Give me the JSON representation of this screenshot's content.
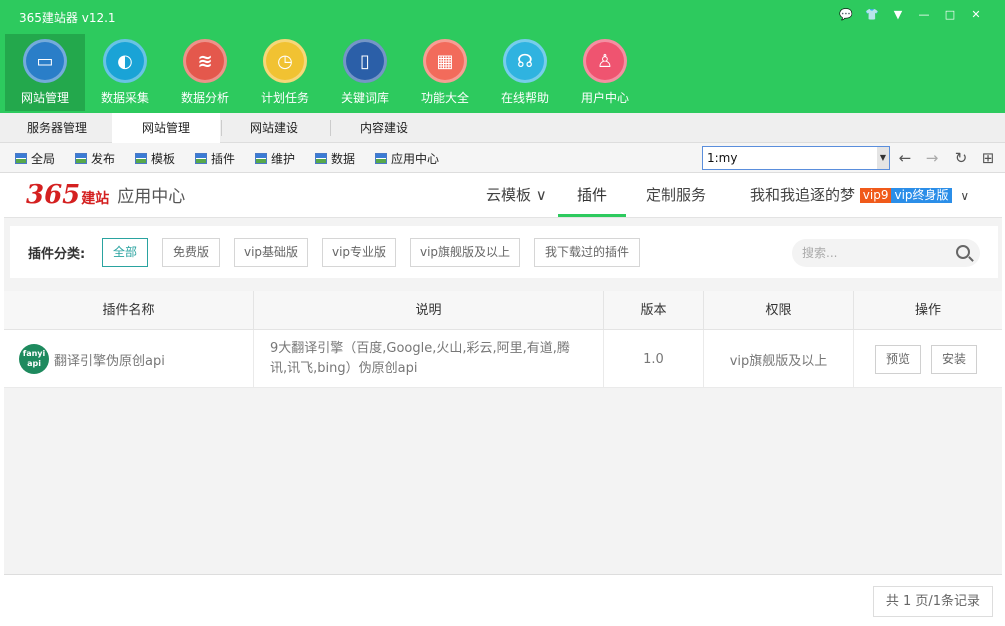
{
  "app": {
    "title": "365建站器 v12.1"
  },
  "window_controls": {
    "chat": "💬",
    "skin": "👕",
    "menu": "▼",
    "minimize": "—",
    "maximize": "□",
    "close": "✕"
  },
  "main_nav": [
    {
      "label": "网站管理",
      "icon": "monitor-icon",
      "glyph": "▭",
      "color": "#2a7ec8"
    },
    {
      "label": "数据采集",
      "icon": "globe-icon",
      "glyph": "◐",
      "color": "#1aa3d6"
    },
    {
      "label": "数据分析",
      "icon": "database-icon",
      "glyph": "≋",
      "color": "#e4584c"
    },
    {
      "label": "计划任务",
      "icon": "clock-icon",
      "glyph": "◷",
      "color": "#f1c232"
    },
    {
      "label": "关键词库",
      "icon": "book-icon",
      "glyph": "▯",
      "color": "#2b5fa8"
    },
    {
      "label": "功能大全",
      "icon": "grid-icon",
      "glyph": "▦",
      "color": "#f26b5b"
    },
    {
      "label": "在线帮助",
      "icon": "headset-icon",
      "glyph": "☊",
      "color": "#2fb3e0"
    },
    {
      "label": "用户中心",
      "icon": "user-icon",
      "glyph": "♙",
      "color": "#ef5470"
    }
  ],
  "tabs": [
    "服务器管理",
    "网站管理",
    "网站建设",
    "内容建设"
  ],
  "toolbar": [
    "全局",
    "发布",
    "模板",
    "插件",
    "维护",
    "数据",
    "应用中心"
  ],
  "url": {
    "value": "1:my",
    "back": "←",
    "forward": "→",
    "refresh": "↻",
    "grid": "⊞"
  },
  "app_center": {
    "logo_num": "365",
    "logo_cn": "建站",
    "title": "应用中心",
    "nav": {
      "templates": "云模板 ∨",
      "plugins": "插件",
      "custom": "定制服务"
    },
    "user": {
      "name": "我和我追逐的梦",
      "vip": "vip9",
      "vip_type": "vip终身版",
      "arrow": "∨"
    }
  },
  "filter": {
    "label": "插件分类:",
    "options": [
      "全部",
      "免费版",
      "vip基础版",
      "vip专业版",
      "vip旗舰版及以上",
      "我下载过的插件"
    ],
    "search_placeholder": "搜索..."
  },
  "table": {
    "headers": [
      "插件名称",
      "说明",
      "版本",
      "权限",
      "操作"
    ],
    "rows": [
      {
        "logo_line1": "fanyi",
        "logo_line2": "api",
        "name": "翻译引擎伪原创api",
        "desc": "9大翻译引擎（百度,Google,火山,彩云,阿里,有道,腾讯,讯飞,bing）伪原创api",
        "version": "1.0",
        "permission": "vip旗舰版及以上",
        "preview": "预览",
        "install": "安装"
      }
    ]
  },
  "pager": "共 1 页/1条记录"
}
